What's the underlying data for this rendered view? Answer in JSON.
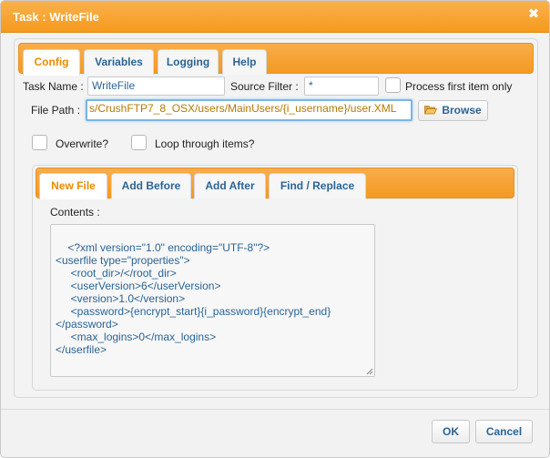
{
  "dialog": {
    "title": "Task : WriteFile",
    "close_glyph": "✖"
  },
  "tabs": [
    {
      "label": "Config",
      "active": true
    },
    {
      "label": "Variables",
      "active": false
    },
    {
      "label": "Logging",
      "active": false
    },
    {
      "label": "Help",
      "active": false
    }
  ],
  "config": {
    "task_name_label": "Task Name :",
    "task_name_value": "WriteFile",
    "source_filter_label": "Source Filter :",
    "source_filter_value": "*",
    "process_first_label": "Process first item only",
    "process_first_checked": false,
    "file_path_label": "File Path :",
    "file_path_value": "s/CrushFTP7_8_OSX/users/MainUsers/{i_username}/user.XML",
    "browse_label": "Browse",
    "browse_icon": "folder-open-icon",
    "overwrite_label": "Overwrite?",
    "overwrite_checked": false,
    "loop_label": "Loop through items?",
    "loop_checked": false
  },
  "sub_tabs": [
    {
      "label": "New File",
      "active": true
    },
    {
      "label": "Add Before",
      "active": false
    },
    {
      "label": "Add After",
      "active": false
    },
    {
      "label": "Find / Replace",
      "active": false
    }
  ],
  "contents": {
    "label": "Contents :",
    "text": "<?xml version=\"1.0\" encoding=\"UTF-8\"?>\n<userfile type=\"properties\">\n     <root_dir>/</root_dir>\n     <userVersion>6</userVersion>\n     <version>1.0</version>\n     <password>{encrypt_start}{i_password}{encrypt_end}\n</password>\n     <max_logins>0</max_logins>\n</userfile>"
  },
  "footer": {
    "ok_label": "OK",
    "cancel_label": "Cancel"
  },
  "colors": {
    "accent": "#f59a1d",
    "link_text": "#2a6496",
    "active_tab_text": "#eb8b00"
  }
}
